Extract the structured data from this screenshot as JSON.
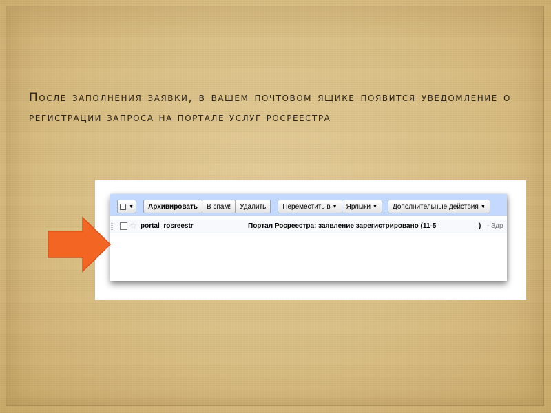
{
  "slide": {
    "text": "После заполнения заявки, в вашем почтовом ящике появится уведомление о регистрации запроса на портале услуг Росреестра"
  },
  "toolbar": {
    "archive_label": "Архивировать",
    "spam_label": "В спам!",
    "delete_label": "Удалить",
    "move_label": "Переместить в",
    "labels_label": "Ярлыки",
    "more_actions_label": "Дополнительные действия"
  },
  "message": {
    "sender": "portal_rosreestr",
    "subject": "Портал Росреестра: заявление зарегистрировано (11-5",
    "subject_end": ")",
    "snippet": "- Здр"
  },
  "icons": {
    "arrow": "right-arrow-icon",
    "star": "star-icon",
    "dropdown": "chevron-down-icon"
  },
  "colors": {
    "arrow": "#f26522",
    "toolbar_bg": "#c3d9ff",
    "background": "#dcc289"
  }
}
